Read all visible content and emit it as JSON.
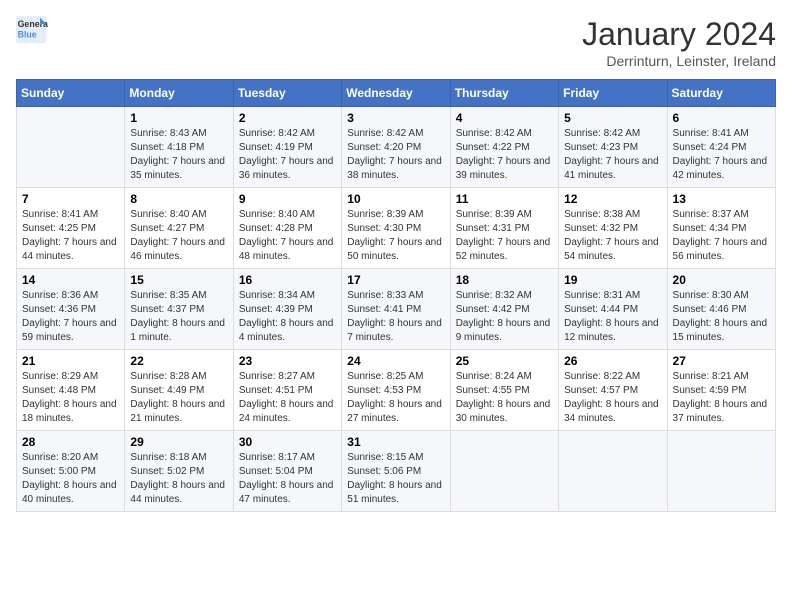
{
  "logo": {
    "line1": "General",
    "line2": "Blue"
  },
  "title": {
    "month_year": "January 2024",
    "location": "Derrinturn, Leinster, Ireland"
  },
  "days_of_week": [
    "Sunday",
    "Monday",
    "Tuesday",
    "Wednesday",
    "Thursday",
    "Friday",
    "Saturday"
  ],
  "weeks": [
    [
      {
        "day": "",
        "sunrise": "",
        "sunset": "",
        "daylight": ""
      },
      {
        "day": "1",
        "sunrise": "8:43 AM",
        "sunset": "4:18 PM",
        "daylight": "7 hours and 35 minutes."
      },
      {
        "day": "2",
        "sunrise": "8:42 AM",
        "sunset": "4:19 PM",
        "daylight": "7 hours and 36 minutes."
      },
      {
        "day": "3",
        "sunrise": "8:42 AM",
        "sunset": "4:20 PM",
        "daylight": "7 hours and 38 minutes."
      },
      {
        "day": "4",
        "sunrise": "8:42 AM",
        "sunset": "4:22 PM",
        "daylight": "7 hours and 39 minutes."
      },
      {
        "day": "5",
        "sunrise": "8:42 AM",
        "sunset": "4:23 PM",
        "daylight": "7 hours and 41 minutes."
      },
      {
        "day": "6",
        "sunrise": "8:41 AM",
        "sunset": "4:24 PM",
        "daylight": "7 hours and 42 minutes."
      }
    ],
    [
      {
        "day": "7",
        "sunrise": "8:41 AM",
        "sunset": "4:25 PM",
        "daylight": "7 hours and 44 minutes."
      },
      {
        "day": "8",
        "sunrise": "8:40 AM",
        "sunset": "4:27 PM",
        "daylight": "7 hours and 46 minutes."
      },
      {
        "day": "9",
        "sunrise": "8:40 AM",
        "sunset": "4:28 PM",
        "daylight": "7 hours and 48 minutes."
      },
      {
        "day": "10",
        "sunrise": "8:39 AM",
        "sunset": "4:30 PM",
        "daylight": "7 hours and 50 minutes."
      },
      {
        "day": "11",
        "sunrise": "8:39 AM",
        "sunset": "4:31 PM",
        "daylight": "7 hours and 52 minutes."
      },
      {
        "day": "12",
        "sunrise": "8:38 AM",
        "sunset": "4:32 PM",
        "daylight": "7 hours and 54 minutes."
      },
      {
        "day": "13",
        "sunrise": "8:37 AM",
        "sunset": "4:34 PM",
        "daylight": "7 hours and 56 minutes."
      }
    ],
    [
      {
        "day": "14",
        "sunrise": "8:36 AM",
        "sunset": "4:36 PM",
        "daylight": "7 hours and 59 minutes."
      },
      {
        "day": "15",
        "sunrise": "8:35 AM",
        "sunset": "4:37 PM",
        "daylight": "8 hours and 1 minute."
      },
      {
        "day": "16",
        "sunrise": "8:34 AM",
        "sunset": "4:39 PM",
        "daylight": "8 hours and 4 minutes."
      },
      {
        "day": "17",
        "sunrise": "8:33 AM",
        "sunset": "4:41 PM",
        "daylight": "8 hours and 7 minutes."
      },
      {
        "day": "18",
        "sunrise": "8:32 AM",
        "sunset": "4:42 PM",
        "daylight": "8 hours and 9 minutes."
      },
      {
        "day": "19",
        "sunrise": "8:31 AM",
        "sunset": "4:44 PM",
        "daylight": "8 hours and 12 minutes."
      },
      {
        "day": "20",
        "sunrise": "8:30 AM",
        "sunset": "4:46 PM",
        "daylight": "8 hours and 15 minutes."
      }
    ],
    [
      {
        "day": "21",
        "sunrise": "8:29 AM",
        "sunset": "4:48 PM",
        "daylight": "8 hours and 18 minutes."
      },
      {
        "day": "22",
        "sunrise": "8:28 AM",
        "sunset": "4:49 PM",
        "daylight": "8 hours and 21 minutes."
      },
      {
        "day": "23",
        "sunrise": "8:27 AM",
        "sunset": "4:51 PM",
        "daylight": "8 hours and 24 minutes."
      },
      {
        "day": "24",
        "sunrise": "8:25 AM",
        "sunset": "4:53 PM",
        "daylight": "8 hours and 27 minutes."
      },
      {
        "day": "25",
        "sunrise": "8:24 AM",
        "sunset": "4:55 PM",
        "daylight": "8 hours and 30 minutes."
      },
      {
        "day": "26",
        "sunrise": "8:22 AM",
        "sunset": "4:57 PM",
        "daylight": "8 hours and 34 minutes."
      },
      {
        "day": "27",
        "sunrise": "8:21 AM",
        "sunset": "4:59 PM",
        "daylight": "8 hours and 37 minutes."
      }
    ],
    [
      {
        "day": "28",
        "sunrise": "8:20 AM",
        "sunset": "5:00 PM",
        "daylight": "8 hours and 40 minutes."
      },
      {
        "day": "29",
        "sunrise": "8:18 AM",
        "sunset": "5:02 PM",
        "daylight": "8 hours and 44 minutes."
      },
      {
        "day": "30",
        "sunrise": "8:17 AM",
        "sunset": "5:04 PM",
        "daylight": "8 hours and 47 minutes."
      },
      {
        "day": "31",
        "sunrise": "8:15 AM",
        "sunset": "5:06 PM",
        "daylight": "8 hours and 51 minutes."
      },
      {
        "day": "",
        "sunrise": "",
        "sunset": "",
        "daylight": ""
      },
      {
        "day": "",
        "sunrise": "",
        "sunset": "",
        "daylight": ""
      },
      {
        "day": "",
        "sunrise": "",
        "sunset": "",
        "daylight": ""
      }
    ]
  ]
}
